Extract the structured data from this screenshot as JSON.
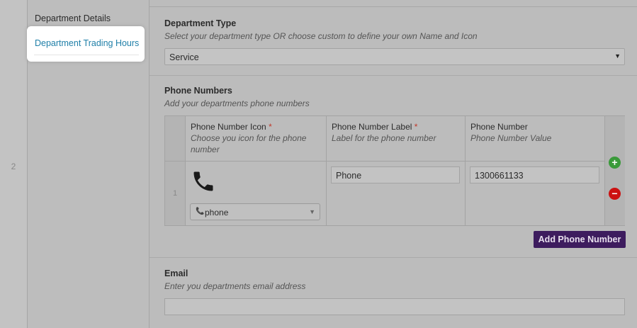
{
  "row": {
    "number": "2"
  },
  "nav": {
    "items": [
      {
        "label": "Department Details"
      },
      {
        "label": "Department Trading Hours"
      }
    ]
  },
  "department_type": {
    "title": "Department Type",
    "description": "Select your department type OR choose custom to define your own Name and Icon",
    "selected": "Service"
  },
  "phone_numbers": {
    "title": "Phone Numbers",
    "description": "Add your departments phone numbers",
    "columns": [
      {
        "label": "Phone Number Icon",
        "required": "*",
        "description": "Choose you icon for the phone number"
      },
      {
        "label": "Phone Number Label",
        "required": "*",
        "description": "Label for the phone number"
      },
      {
        "label": "Phone Number",
        "description": "Phone Number Value"
      }
    ],
    "rows": [
      {
        "index": "1",
        "icon": "phone-icon",
        "icon_select": "phone",
        "label": "Phone",
        "number": "1300661133"
      }
    ],
    "add_button": "Add Phone Number"
  },
  "email": {
    "title": "Email",
    "description": "Enter you departments email address",
    "value": ""
  },
  "colors": {
    "link": "#1f7fa8",
    "primary_button": "#3d1c5e",
    "add_icon": "#3a9a3a",
    "remove_icon": "#cc1111",
    "required_star": "#c0392b"
  }
}
